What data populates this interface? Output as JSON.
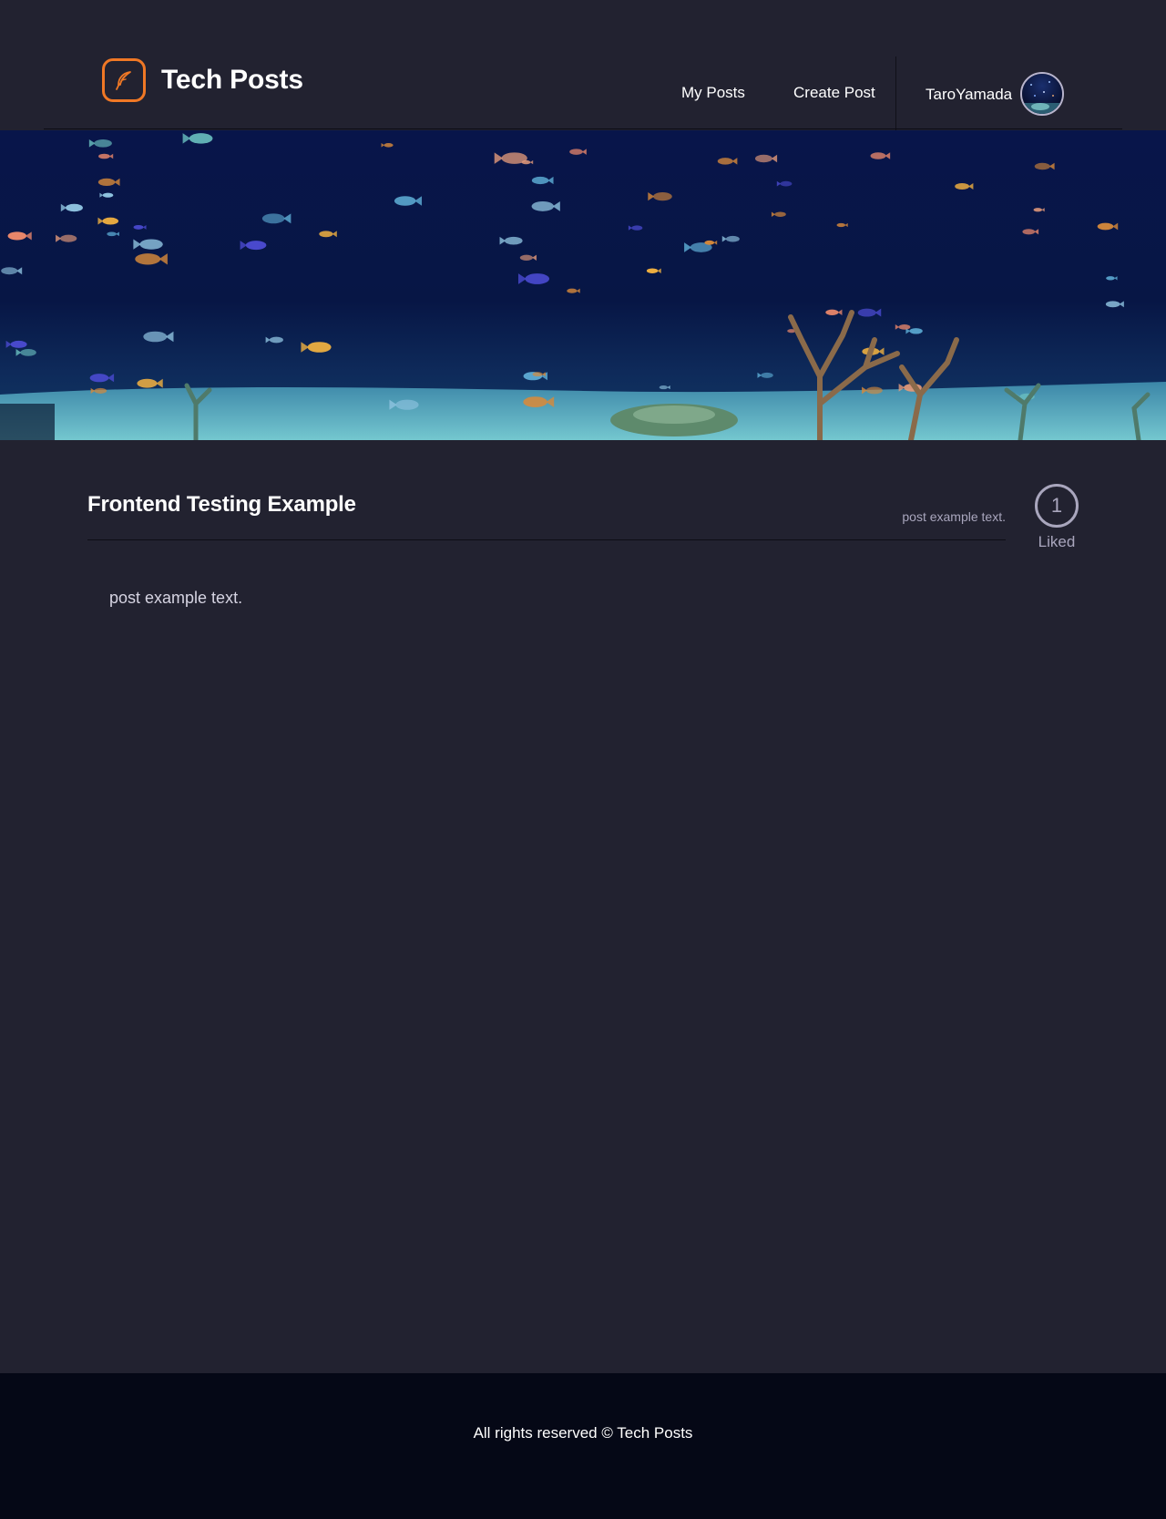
{
  "header": {
    "brand_name": "Tech Posts",
    "logo_icon": "feather-icon",
    "nav": {
      "my_posts": "My Posts",
      "create_post": "Create Post"
    },
    "user": {
      "username": "TaroYamada",
      "avatar_icon": "user-avatar"
    }
  },
  "hero": {
    "image": "aquarium-banner"
  },
  "post": {
    "title": "Frontend Testing Example",
    "subtitle": "post example text.",
    "body": "post example text.",
    "likes": {
      "count": "1",
      "label": "Liked"
    }
  },
  "footer": {
    "text": "All rights reserved © Tech Posts"
  },
  "colors": {
    "background": "#222230",
    "accent": "#f07825",
    "muted": "#a9a6bd",
    "footer_bg": "#050816"
  }
}
